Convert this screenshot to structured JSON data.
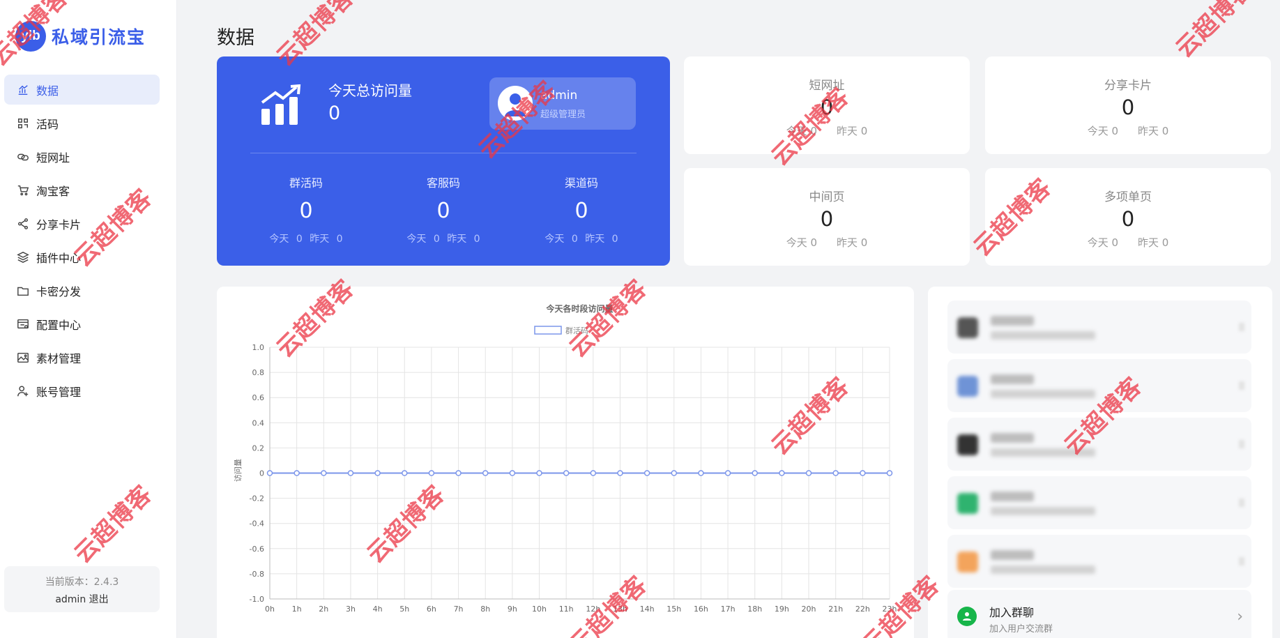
{
  "app": {
    "logo_badge": "ylb",
    "logo_text": "私域引流宝"
  },
  "sidebar": {
    "items": [
      {
        "label": "数据",
        "icon": "bar-chart-icon",
        "active": true
      },
      {
        "label": "活码",
        "icon": "grid-icon"
      },
      {
        "label": "短网址",
        "icon": "link-icon"
      },
      {
        "label": "淘宝客",
        "icon": "cart-icon"
      },
      {
        "label": "分享卡片",
        "icon": "share-icon"
      },
      {
        "label": "插件中心",
        "icon": "layers-icon"
      },
      {
        "label": "卡密分发",
        "icon": "folder-icon"
      },
      {
        "label": "配置中心",
        "icon": "config-icon"
      },
      {
        "label": "素材管理",
        "icon": "image-icon"
      },
      {
        "label": "账号管理",
        "icon": "user-add-icon"
      }
    ],
    "version": "当前版本：2.4.3",
    "user_logout": "admin 退出"
  },
  "page": {
    "title": "数据"
  },
  "hero": {
    "label": "今天总访问量",
    "value": "0",
    "admin_name": "admin",
    "admin_role": "超级管理员",
    "stats": [
      {
        "label": "群活码",
        "value": "0",
        "sub": "今天 0  昨天 0"
      },
      {
        "label": "客服码",
        "value": "0",
        "sub": "今天 0  昨天 0"
      },
      {
        "label": "渠道码",
        "value": "0",
        "sub": "今天 0  昨天 0"
      }
    ],
    "color": "#3b5fe8"
  },
  "cards": [
    {
      "label": "短网址",
      "value": "0",
      "today": "今天 0",
      "yesterday": "昨天 0"
    },
    {
      "label": "分享卡片",
      "value": "0",
      "today": "今天 0",
      "yesterday": "昨天 0"
    },
    {
      "label": "中间页",
      "value": "0",
      "today": "今天 0",
      "yesterday": "昨天 0"
    },
    {
      "label": "多项单页",
      "value": "0",
      "today": "今天 0",
      "yesterday": "昨天 0"
    }
  ],
  "chart_data": {
    "type": "line",
    "title": "今天各时段访问量",
    "ylabel": "访问量",
    "xlabel": "",
    "categories": [
      "0h",
      "1h",
      "2h",
      "3h",
      "4h",
      "5h",
      "6h",
      "7h",
      "8h",
      "9h",
      "10h",
      "11h",
      "12h",
      "13h",
      "14h",
      "15h",
      "16h",
      "17h",
      "18h",
      "19h",
      "20h",
      "21h",
      "22h",
      "23h"
    ],
    "series": [
      {
        "name": "群活码",
        "values": [
          0,
          0,
          0,
          0,
          0,
          0,
          0,
          0,
          0,
          0,
          0,
          0,
          0,
          0,
          0,
          0,
          0,
          0,
          0,
          0,
          0,
          0,
          0,
          0
        ]
      }
    ],
    "ylim": [
      -1.0,
      1.0
    ],
    "yticks": [
      1.0,
      0.8,
      0.6,
      0.4,
      0.2,
      0,
      -0.2,
      -0.4,
      -0.6,
      -0.8,
      -1.0
    ],
    "grid": true,
    "legend": "top-center",
    "line_color": "#7b95ea"
  },
  "side": {
    "blurred_icon_colors": [
      "#555555",
      "#6f93d6",
      "#333333",
      "#2fb36f",
      "#f3a45c"
    ],
    "join_title": "加入群聊",
    "join_sub": "加入用户交流群",
    "join_arrow": "›"
  },
  "watermark": "云超博客"
}
